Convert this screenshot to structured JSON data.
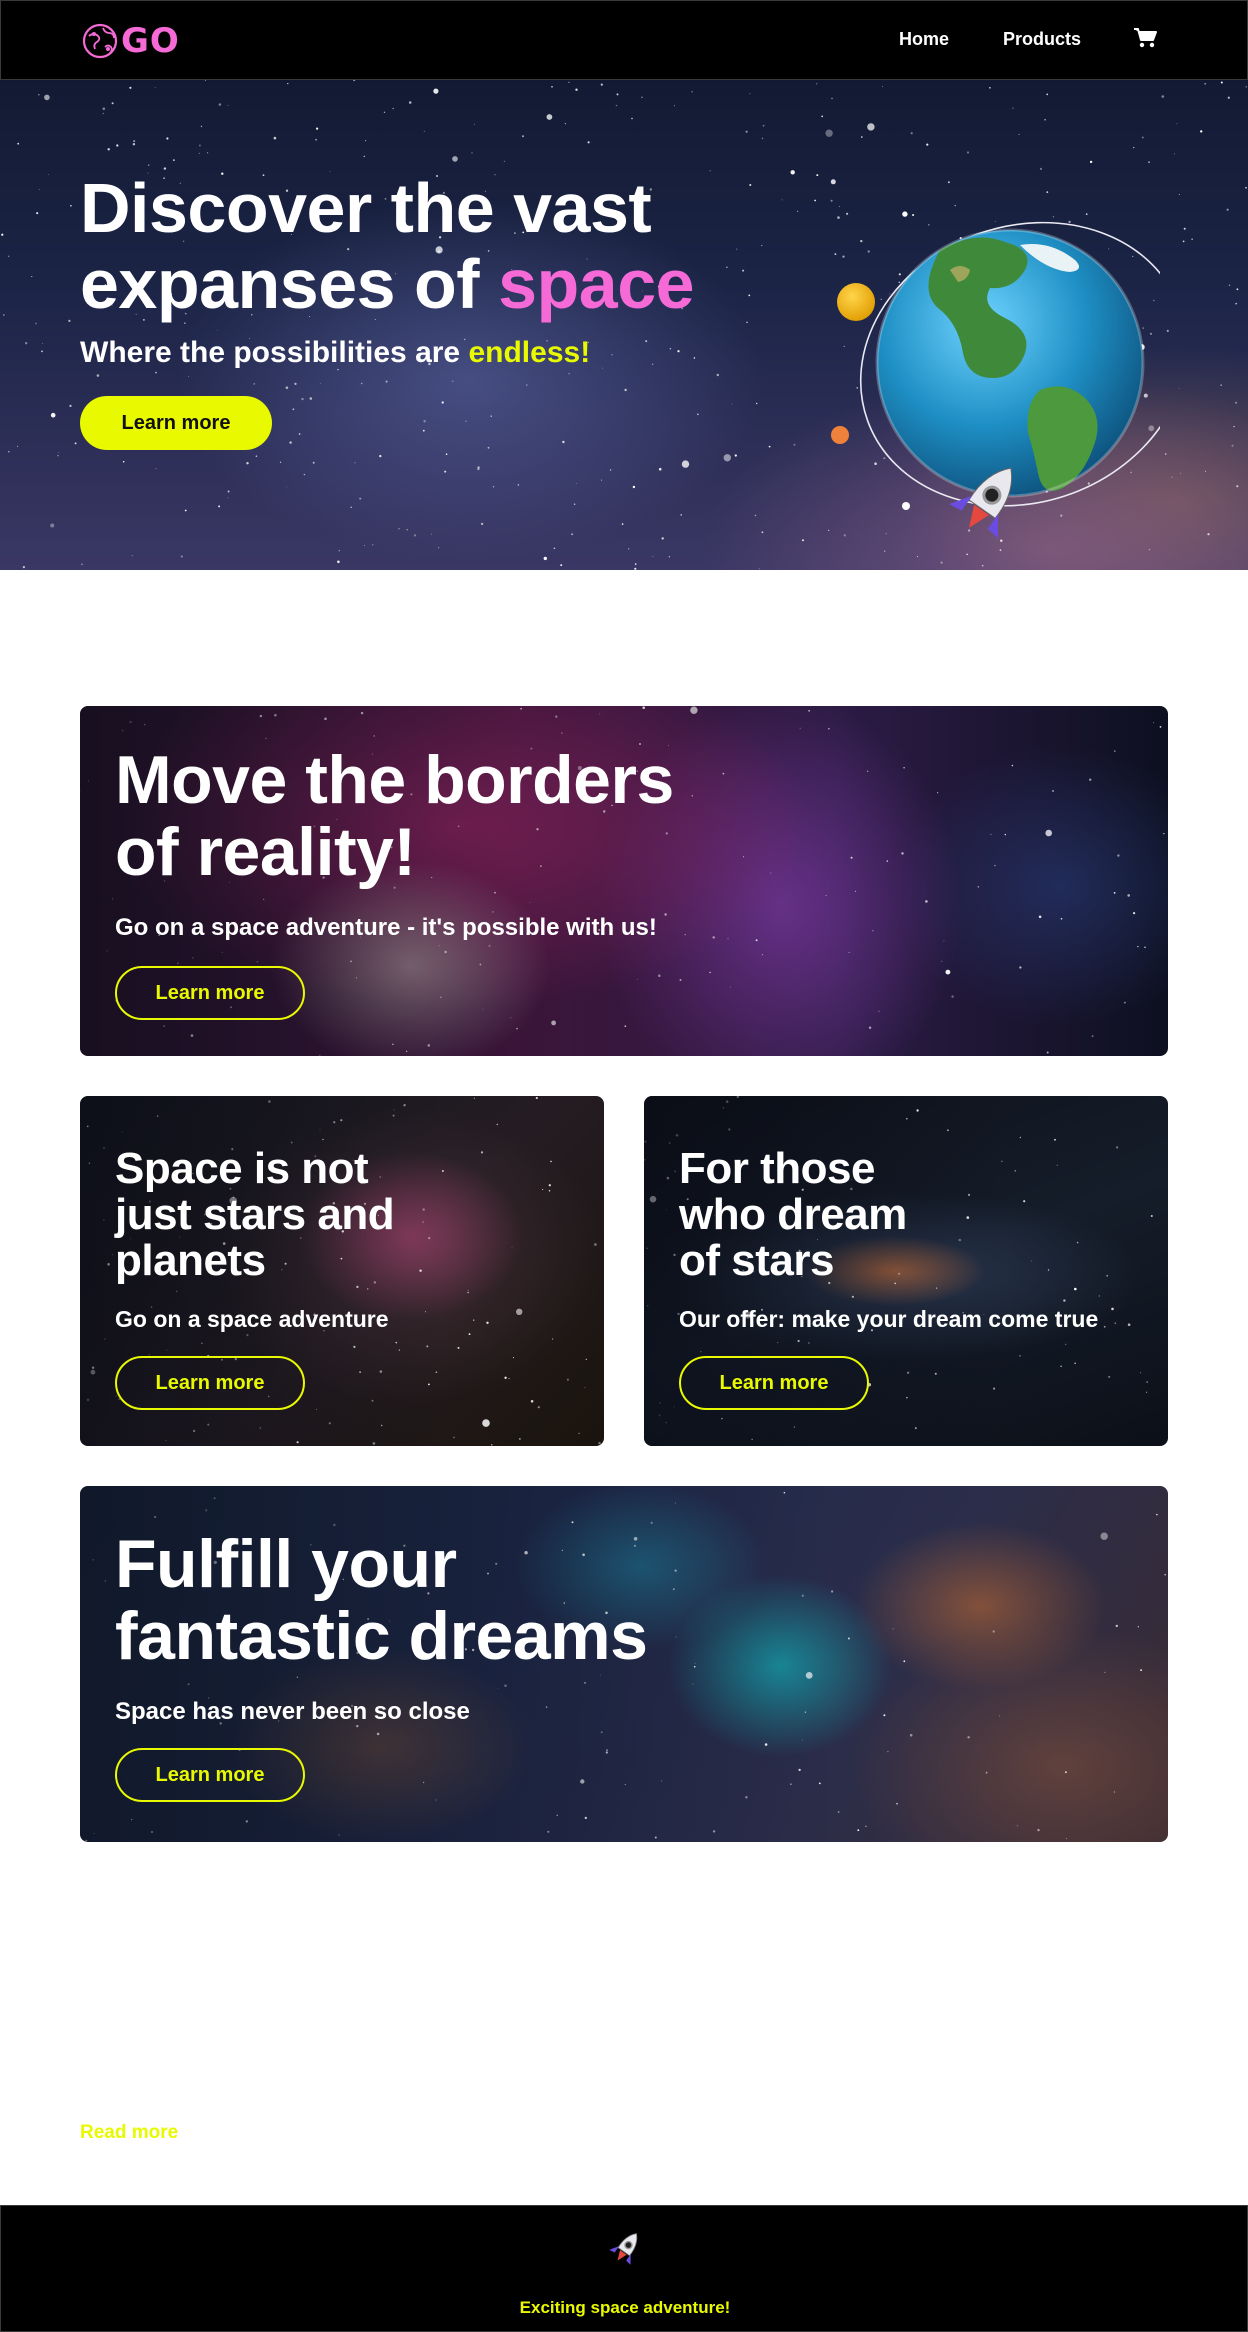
{
  "nav": {
    "logo_text": "GO",
    "links": [
      "Home",
      "Products"
    ],
    "cart_icon": "shopping-cart-icon"
  },
  "hero": {
    "title_part1": "Discover the vast",
    "title_part2": "expanses of",
    "title_accent": "space",
    "subtitle_part1": "Where the possibilities are",
    "subtitle_accent": "endless!",
    "button_label": "Learn more"
  },
  "cards": [
    {
      "title_line1": "Move the borders",
      "title_line2": "of reality!",
      "subtitle": "Go on a space adventure - it's possible with us!",
      "button_label": "Learn more"
    },
    {
      "title_line1": "Space is not",
      "title_line2": "just stars and",
      "title_line3": "planets",
      "subtitle": "Go on a space adventure",
      "button_label": "Learn more"
    },
    {
      "title_line1": "For those",
      "title_line2": "who dream",
      "title_line3": "of stars",
      "subtitle": "Our offer: make your dream come true",
      "button_label": "Learn more"
    },
    {
      "title_line1": "Fulfill your",
      "title_line2": "fantastic dreams",
      "subtitle": "Space has never been so close",
      "button_label": "Learn more"
    }
  ],
  "read_more": "Read more",
  "footer": {
    "text": "Exciting space adventure!",
    "icon": "rocket-icon"
  },
  "colors": {
    "accent_yellow": "#e8f900",
    "accent_pink": "#f56ad6",
    "nav_bg": "#000000"
  }
}
